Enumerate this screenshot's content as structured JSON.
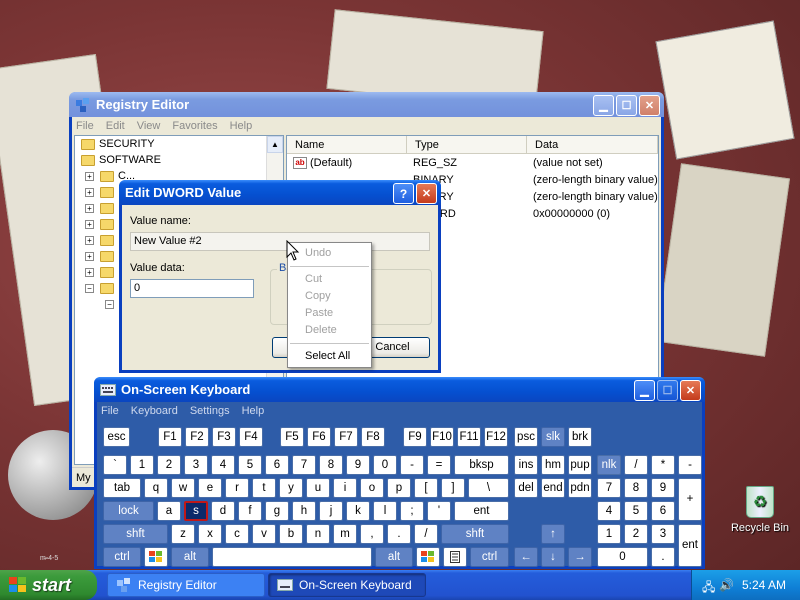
{
  "desktop": {
    "recycle_bin_label": "Recycle Bin",
    "corner_signature": "m̶-4-5"
  },
  "registry": {
    "title": "Registry Editor",
    "menu": [
      "File",
      "Edit",
      "View",
      "Favorites",
      "Help"
    ],
    "tree": [
      {
        "label": "SECURITY"
      },
      {
        "label": "SOFTWARE"
      },
      {
        "label": "C..."
      }
    ],
    "columns": [
      "Name",
      "Type",
      "Data"
    ],
    "rows": [
      {
        "name": "(Default)",
        "type": "REG_SZ",
        "data": "(value not set)"
      },
      {
        "name": "",
        "type": "BINARY",
        "data": "(zero-length binary value)"
      },
      {
        "name": "",
        "type": "BINARY",
        "data": "(zero-length binary value)"
      },
      {
        "name": "",
        "type": "DWORD",
        "data": "0x00000000 (0)"
      }
    ],
    "status": "My C"
  },
  "dialog": {
    "title": "Edit DWORD Value",
    "value_name_label": "Value name:",
    "value_name": "New Value #2",
    "value_data_label": "Value data:",
    "value_data": "0",
    "base_label": "Ba",
    "cancel": "Cancel"
  },
  "context_menu": {
    "items": [
      "Undo",
      "Cut",
      "Copy",
      "Paste",
      "Delete",
      "Select All"
    ]
  },
  "osk": {
    "title": "On-Screen Keyboard",
    "menu": [
      "File",
      "Keyboard",
      "Settings",
      "Help"
    ],
    "rows": {
      "r1": [
        "esc",
        "F1",
        "F2",
        "F3",
        "F4",
        "F5",
        "F6",
        "F7",
        "F8",
        "F9",
        "F10",
        "F11",
        "F12",
        "psc",
        "slk",
        "brk"
      ],
      "r2": [
        "`",
        "1",
        "2",
        "3",
        "4",
        "5",
        "6",
        "7",
        "8",
        "9",
        "0",
        "-",
        "=",
        "bksp",
        "ins",
        "hm",
        "pup",
        "nlk",
        "/",
        "*",
        "-"
      ],
      "r3": [
        "tab",
        "q",
        "w",
        "e",
        "r",
        "t",
        "y",
        "u",
        "i",
        "o",
        "p",
        "[",
        "]",
        "\\",
        "del",
        "end",
        "pdn",
        "7",
        "8",
        "9",
        "+"
      ],
      "r4": [
        "lock",
        "a",
        "s",
        "d",
        "f",
        "g",
        "h",
        "j",
        "k",
        "l",
        ";",
        "'",
        "ent",
        "4",
        "5",
        "6"
      ],
      "r5": [
        "shft",
        "z",
        "x",
        "c",
        "v",
        "b",
        "n",
        "m",
        ",",
        ".",
        "/",
        "shft",
        "↑",
        "1",
        "2",
        "3",
        "ent"
      ],
      "r6": [
        "ctrl",
        "alt",
        "alt",
        "ctrl",
        "←",
        "↓",
        "→",
        "0",
        "."
      ]
    }
  },
  "taskbar": {
    "start": "start",
    "items": [
      "Registry Editor",
      "On-Screen Keyboard"
    ],
    "clock": "5:24 AM"
  },
  "colors": {
    "xp_blue": "#0a3fbf",
    "osk_bg": "#2e5ca8",
    "start_green": "#3c9b3c",
    "pressed_key_border": "#c01818"
  }
}
